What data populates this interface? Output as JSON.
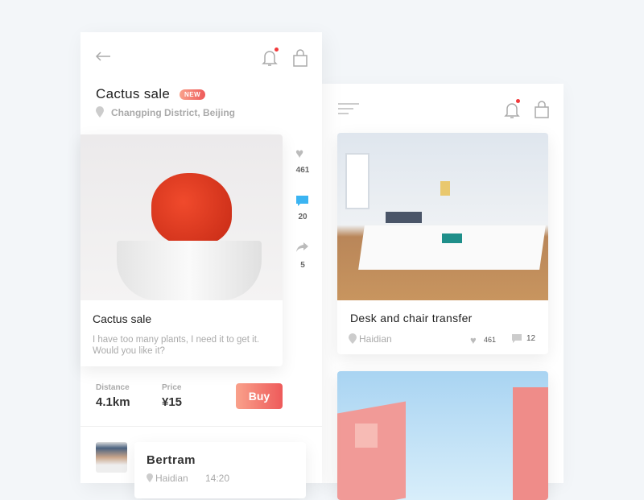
{
  "left": {
    "title": "Cactus sale",
    "badge": "NEW",
    "location": "Changping District, Beijing",
    "card": {
      "title": "Cactus sale",
      "description": "I have too many plants, I need it to get it. Would you like it?"
    },
    "actions": {
      "likes": "461",
      "comments": "20",
      "shares": "5"
    },
    "distance_label": "Distance",
    "distance": "4.1km",
    "price_label": "Price",
    "price": "¥15",
    "buy_label": "Buy",
    "comment": {
      "name": "Bertram",
      "location": "Haidian",
      "time": "14:20"
    }
  },
  "right": {
    "items": [
      {
        "title": "Desk and chair transfer",
        "location": "Haidian",
        "likes": "461",
        "comments": "12"
      }
    ]
  },
  "colors": {
    "accent": "#ee5a5a",
    "comment": "#3bb4f2",
    "notification": "#f2393b"
  }
}
